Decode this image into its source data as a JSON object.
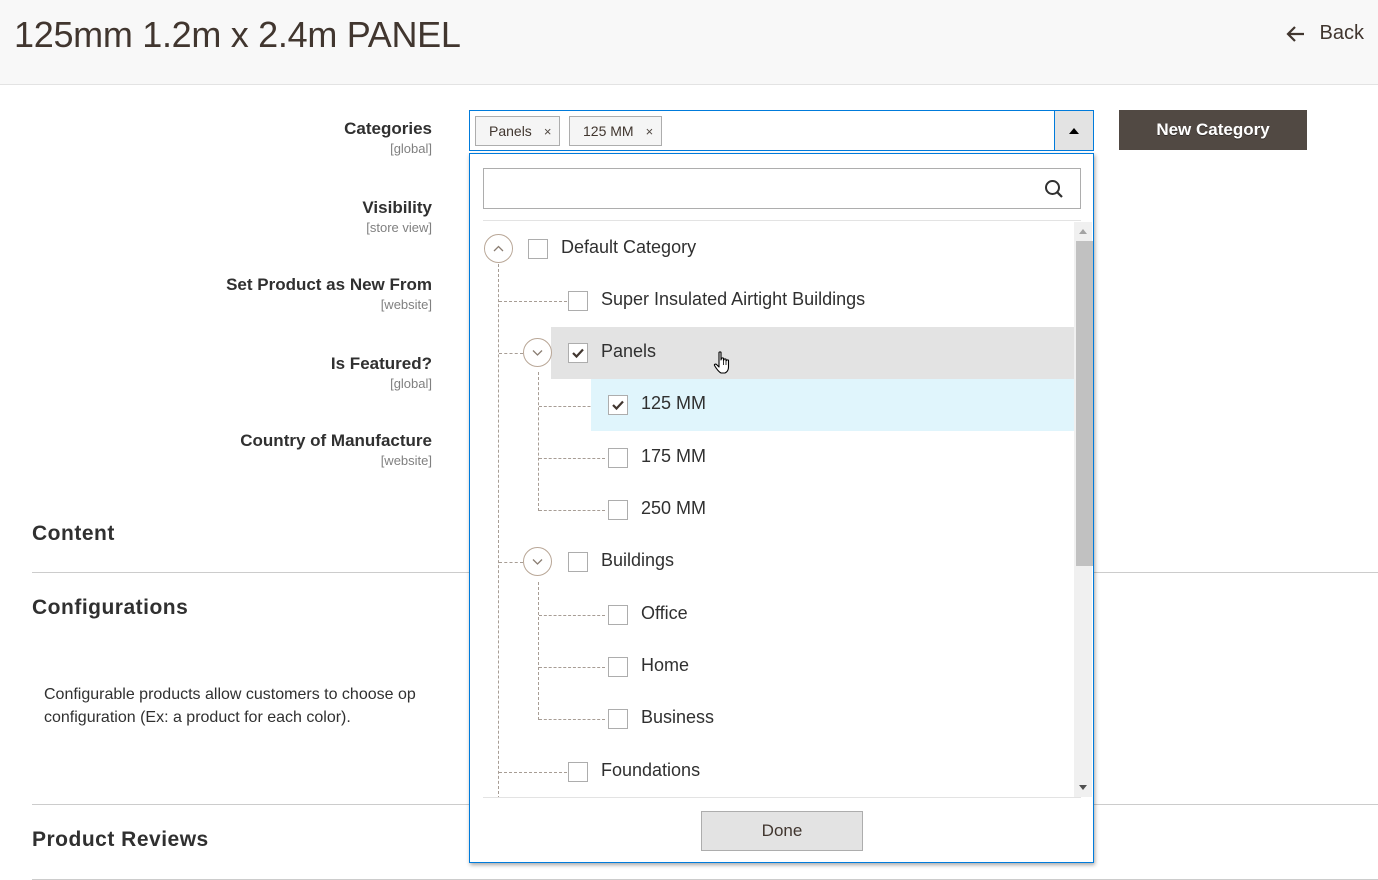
{
  "header": {
    "title": "125mm 1.2m x 2.4m PANEL",
    "back_label": "Back",
    "back_icon": "arrow-left-icon"
  },
  "fields": [
    {
      "label": "Categories",
      "scope": "[global]"
    },
    {
      "label": "Visibility",
      "scope": "[store view]"
    },
    {
      "label": "Set Product as New From",
      "scope": "[website]"
    },
    {
      "label": "Is Featured?",
      "scope": "[global]"
    },
    {
      "label": "Country of Manufacture",
      "scope": "[website]"
    }
  ],
  "categories_select": {
    "chips": [
      {
        "label": "Panels",
        "remove": "×"
      },
      {
        "label": "125 MM",
        "remove": "×"
      }
    ],
    "toggle_icon": "triangle-up-icon",
    "new_category_label": "New Category",
    "search": {
      "value": "",
      "placeholder": "",
      "icon": "search-icon"
    },
    "done_label": "Done",
    "tree": [
      {
        "label": "Default Category",
        "checked": false,
        "level": 0,
        "expander": "collapse"
      },
      {
        "label": "Super Insulated Airtight Buildings",
        "checked": false,
        "level": 1
      },
      {
        "label": "Panels",
        "checked": true,
        "level": 1,
        "expander": "expand",
        "hovered": true
      },
      {
        "label": "125 MM",
        "checked": true,
        "level": 2,
        "selected": true
      },
      {
        "label": "175 MM",
        "checked": false,
        "level": 2
      },
      {
        "label": "250 MM",
        "checked": false,
        "level": 2
      },
      {
        "label": "Buildings",
        "checked": false,
        "level": 1,
        "expander": "expand"
      },
      {
        "label": "Office",
        "checked": false,
        "level": 2
      },
      {
        "label": "Home",
        "checked": false,
        "level": 2
      },
      {
        "label": "Business",
        "checked": false,
        "level": 2
      },
      {
        "label": "Foundations",
        "checked": false,
        "level": 1
      }
    ]
  },
  "sections": {
    "content": "Content",
    "configurations": "Configurations",
    "configurations_text_1": "Configurable products allow customers to choose op",
    "configurations_text_2": "configuration (Ex: a product for each color).",
    "product_reviews": "Product Reviews"
  },
  "colors": {
    "accent_border": "#007bdb",
    "primary_button": "#514943",
    "hover_row": "#e3e3e3",
    "selected_row": "#e0f5fc"
  }
}
